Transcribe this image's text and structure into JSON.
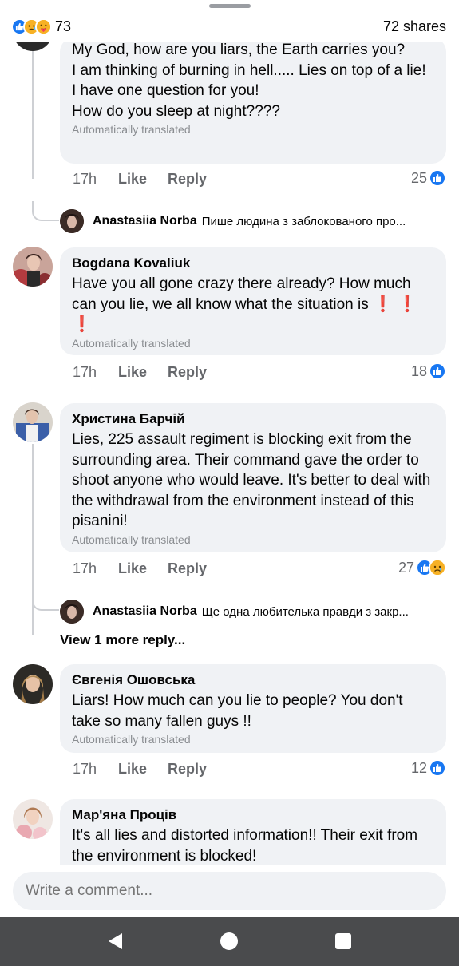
{
  "header": {
    "reaction_count": "73",
    "shares": "72 shares",
    "reaction_icons": [
      "like-icon",
      "sad-icon",
      "care-icon"
    ]
  },
  "comments": [
    {
      "author": "",
      "text": "My God, how are you liars, the Earth carries you?\nI am thinking of burning in hell..... Lies on top of a lie!\nI have one question for you!\nHow do you sleep at night????",
      "translated": "Automatically translated",
      "time": "17h",
      "like": "Like",
      "reply": "Reply",
      "reactions": "25"
    },
    {
      "author": "Bogdana Kovaliuk",
      "text": "Have you all gone crazy there already? How much can you lie, we all know what the situation is",
      "emoji": "❗ ❗ ❗",
      "translated": "Automatically translated",
      "time": "17h",
      "like": "Like",
      "reply": "Reply",
      "reactions": "18"
    },
    {
      "author": "Христина Барчій",
      "text": "Lies, 225 assault regiment is blocking exit from the surrounding area. Their command gave the order to shoot anyone who would leave. It's better to deal with the withdrawal from the environment instead of this pisanini!",
      "translated": "Automatically translated",
      "time": "17h",
      "like": "Like",
      "reply": "Reply",
      "reactions": "27"
    },
    {
      "author": "Євгенія Ошовська",
      "text": "Liars! How much can you lie to people? You don't take so many fallen guys !!",
      "translated": "Automatically translated",
      "time": "17h",
      "like": "Like",
      "reply": "Reply",
      "reactions": "12"
    },
    {
      "author": "Мар'яна Проців",
      "text": "It's all lies and distorted information!! Their exit from the environment is blocked!"
    }
  ],
  "replies": [
    {
      "author": "Anastasiia Norba",
      "text": "Пише людина з заблокованого про..."
    },
    {
      "author": "Anastasiia Norba",
      "text": "Ще одна любителька правди з закр..."
    }
  ],
  "view_more": "View 1 more reply...",
  "composer": {
    "placeholder": "Write a comment..."
  },
  "colors": {
    "accent": "#1877f2",
    "bubble": "#f0f2f5",
    "muted": "#65676b",
    "nav": "#4a4b4d"
  }
}
